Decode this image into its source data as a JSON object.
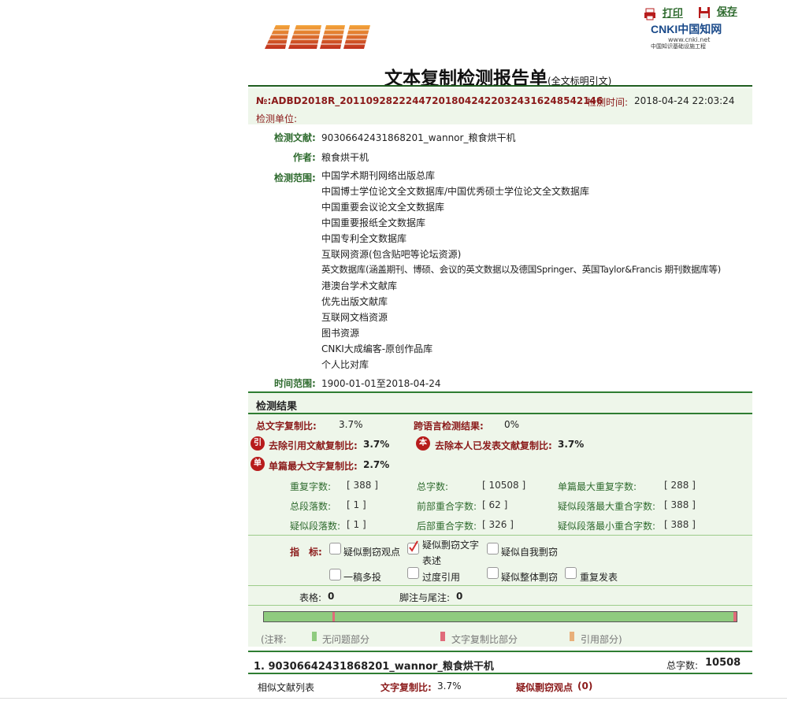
{
  "header": {
    "print_label": "打印",
    "save_label": "保存",
    "logo_text": "AMLC",
    "cnki_logo_text": "CNKI中国知网",
    "cnki_url": "www.cnki.net",
    "cnki_sub": "中国知识基础设施工程",
    "title": "文本复制检测报告单",
    "subtitle": "(全文标明引文)"
  },
  "report": {
    "id": "№:ADBD2018R_20110928222447201804242203243162485421​46",
    "time_label": "检测时间:",
    "time_value": "2018-04-24 22:03:24",
    "unit_label": "检测单位:",
    "doc_label": "检测文献:",
    "doc_value": "90306642431868201_wannor_粮食烘干机",
    "author_label": "作者:",
    "author_value": "粮食烘干机",
    "range_label": "检测范围:",
    "ranges": [
      "中国学术期刊网络出版总库",
      "中国博士学位论文全文数据库/中国优秀硕士学位论文全文数据库",
      "中国重要会议论文全文数据库",
      "中国重要报纸全文数据库",
      "中国专利全文数据库",
      "互联网资源(包含贴吧等论坛资源)",
      "英文数据库(涵盖期刊、博硕、会议的英文数据以及德国Springer、英国Taylor&Francis 期刊数据库等)",
      "港澳台学术文献库",
      "优先出版文献库",
      "互联网文档资源",
      "图书资源",
      "CNKI大成编客-原创作品库",
      "个人比对库"
    ],
    "time_range_label": "时间范围:",
    "time_range_value": "1900-01-01至2018-04-24"
  },
  "results": {
    "section_title": "检测结果",
    "total_ratio_label": "总文字复制比:",
    "total_ratio_value": "3.7%",
    "cross_label": "跨语言检测结果:",
    "cross_value": "0%",
    "badge_yin": "引",
    "excl_cite_label": "去除引用文献复制比:",
    "excl_cite_value": "3.7%",
    "badge_ben": "本",
    "excl_self_label": "去除本人已发表文献复制比:",
    "excl_self_value": "3.7%",
    "badge_dan": "单",
    "single_max_label": "单篇最大文字复制比:",
    "single_max_value": "2.7%",
    "stats": [
      {
        "label": "重复字数:",
        "value": "[ 388 ]"
      },
      {
        "label": "总字数:",
        "value": "[ 10508 ]"
      },
      {
        "label": "单篇最大重复字数:",
        "value": "[ 288 ]"
      },
      {
        "label": "总段落数:",
        "value": "[ 1 ]"
      },
      {
        "label": "前部重合字数:",
        "value": "[ 62 ]"
      },
      {
        "label": "疑似段落最大重合字数:",
        "value": "[ 388 ]"
      },
      {
        "label": "疑似段落数:",
        "value": "[ 1 ]"
      },
      {
        "label": "后部重合字数:",
        "value": "[ 326 ]"
      },
      {
        "label": "疑似段落最小重合字数:",
        "value": "[ 388 ]"
      }
    ]
  },
  "indicators": {
    "label": "指　标:",
    "items": [
      {
        "text": "疑似剽窃观点",
        "checked": false
      },
      {
        "text": "疑似剽窃文字表述",
        "checked": true
      },
      {
        "text": "疑似自我剽窃",
        "checked": false
      },
      {
        "text": "一稿多投",
        "checked": false
      },
      {
        "text": "过度引用",
        "checked": false
      },
      {
        "text": "疑似整体剽窃",
        "checked": false
      },
      {
        "text": "重复发表",
        "checked": false
      }
    ],
    "text_line1": "疑似剽窃文字",
    "text_line2": "表述"
  },
  "tables": {
    "table_label": "表格:",
    "table_value": "0",
    "footnote_label": "脚注与尾注:",
    "footnote_value": "0"
  },
  "bar": {
    "clean_fraction": 0.98,
    "marks": [
      0.145,
      0.995
    ],
    "color_clean": "#8fcb7f",
    "color_copy": "#e06b7a",
    "color_cite": "#e8b07a"
  },
  "legend": {
    "prefix": "(注释:",
    "clean": "无问题部分",
    "copy": "文字复制比部分",
    "cite": "引用部分)"
  },
  "doc_item": {
    "title": "1. 90306642431868201_wannor_粮食烘干机",
    "total_label": "总字数:",
    "total_value": "10508",
    "similar_label": "相似文献列表",
    "ratio_label": "文字复制比:",
    "ratio_value": "3.7%",
    "suspect_label": "疑似剽窃观点",
    "suspect_value": "(0)"
  }
}
